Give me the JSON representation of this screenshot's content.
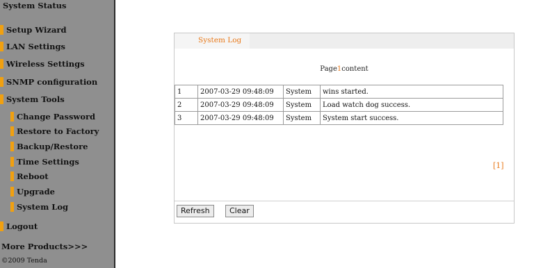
{
  "sidebar": {
    "items": [
      {
        "label": "System Status",
        "sub": false
      },
      {
        "label": "Setup Wizard",
        "sub": false
      },
      {
        "label": "LAN Settings",
        "sub": false
      },
      {
        "label": "Wireless Settings",
        "sub": false
      },
      {
        "label": "SNMP configuration",
        "sub": false
      },
      {
        "label": "System Tools",
        "sub": false
      },
      {
        "label": "Change Password",
        "sub": true
      },
      {
        "label": "Restore to Factory",
        "sub": true
      },
      {
        "label": "Backup/Restore",
        "sub": true
      },
      {
        "label": "Time Settings",
        "sub": true
      },
      {
        "label": "Reboot",
        "sub": true
      },
      {
        "label": "Upgrade",
        "sub": true
      },
      {
        "label": "System Log",
        "sub": true
      },
      {
        "label": "Logout",
        "sub": false
      },
      {
        "label": "More Products>>>",
        "sub": false
      }
    ],
    "copyright": "©2009 Tenda"
  },
  "main": {
    "title": "System Log",
    "page_prefix": "Page",
    "page_number": "1",
    "page_suffix": "content",
    "log_rows": [
      {
        "index": "1",
        "time": "2007-03-29 09:48:09",
        "type": "System",
        "message": "wins started."
      },
      {
        "index": "2",
        "time": "2007-03-29 09:48:09",
        "type": "System",
        "message": "Load watch dog success."
      },
      {
        "index": "3",
        "time": "2007-03-29 09:48:09",
        "type": "System",
        "message": "System start success."
      }
    ],
    "pager": "[1]",
    "buttons": {
      "refresh": "Refresh",
      "clear": "Clear"
    }
  },
  "colors": {
    "sidebar_bg": "#8f8f8f",
    "accent": "#f0a010",
    "title_text": "#e87818"
  }
}
